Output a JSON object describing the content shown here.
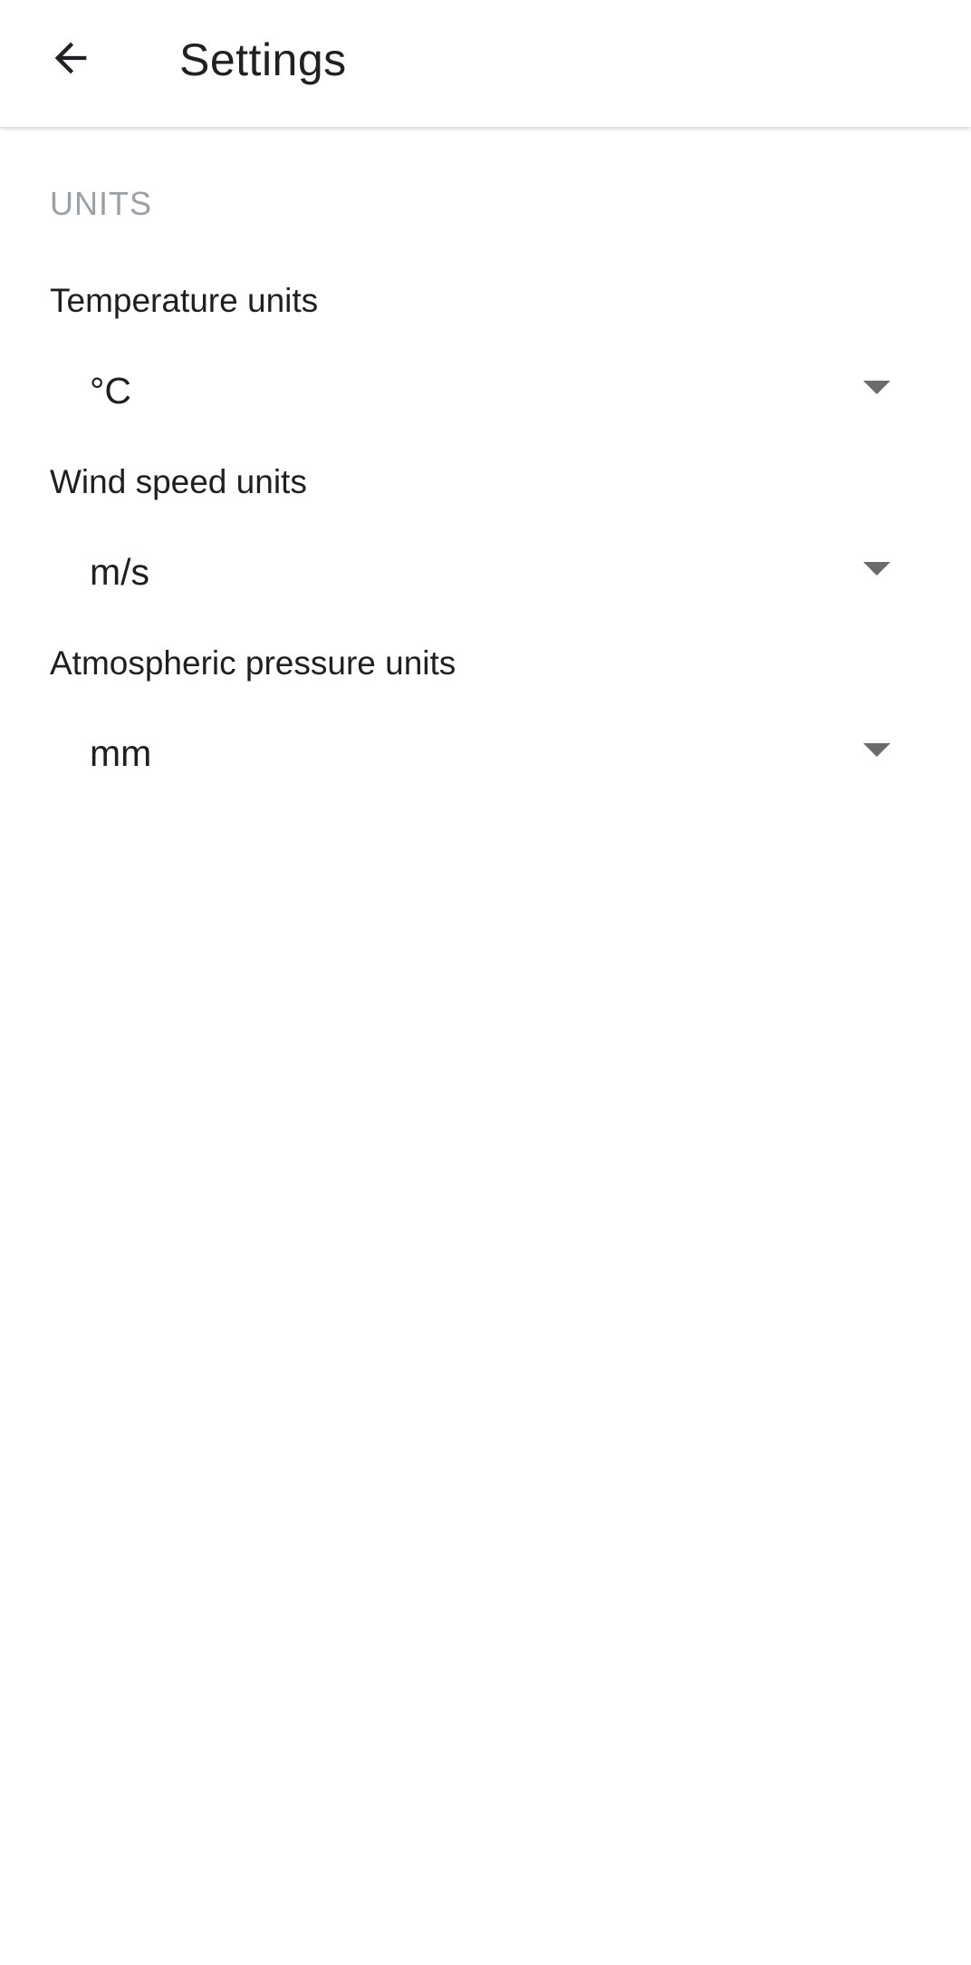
{
  "app_bar": {
    "title": "Settings",
    "back_icon": "arrow-back-icon"
  },
  "section": {
    "header": "UNITS"
  },
  "preferences": [
    {
      "label": "Temperature units",
      "value": "°C"
    },
    {
      "label": "Wind speed units",
      "value": "m/s"
    },
    {
      "label": "Atmospheric pressure units",
      "value": "mm"
    }
  ],
  "colors": {
    "section_header": "#9aa0a6",
    "text_primary": "#1f1f1f",
    "dropdown_arrow": "#6b6b6b",
    "background": "#ffffff"
  }
}
